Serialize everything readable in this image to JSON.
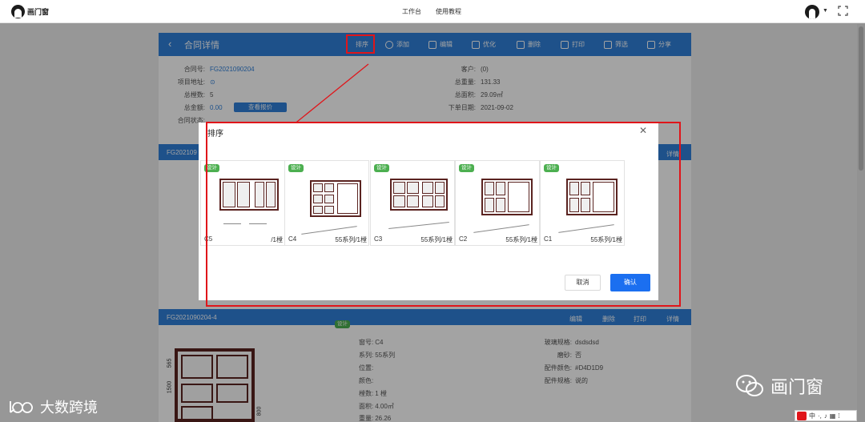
{
  "topbar": {
    "logo_text": "画门窗",
    "nav": [
      "工作台",
      "使用教程"
    ]
  },
  "detail": {
    "title": "合同详情",
    "toolbar": [
      {
        "label": "排序",
        "icon": "sort-icon"
      },
      {
        "label": "添加",
        "icon": "add-circle-icon"
      },
      {
        "label": "编辑",
        "icon": "edit-icon"
      },
      {
        "label": "优化",
        "icon": "grid-icon"
      },
      {
        "label": "删除",
        "icon": "trash-icon"
      },
      {
        "label": "打印",
        "icon": "printer-icon"
      },
      {
        "label": "筛选",
        "icon": "filter-icon"
      },
      {
        "label": "分享",
        "icon": "share-icon"
      }
    ],
    "info_left": [
      {
        "k": "合同号:",
        "v": "FG2021090204"
      },
      {
        "k": "项目地址:",
        "v": "⊙"
      },
      {
        "k": "总樘数:",
        "v": "5"
      },
      {
        "k": "总金额:",
        "v": "0.00"
      },
      {
        "k": "合同状态:",
        "v": ""
      }
    ],
    "quote_button": "查看报价",
    "info_right": [
      {
        "k": "客户:",
        "v": "(0)"
      },
      {
        "k": "总重量:",
        "v": "131.33"
      },
      {
        "k": "总面积:",
        "v": "29.09㎡"
      },
      {
        "k": "下单日期:",
        "v": "2021-09-02"
      }
    ]
  },
  "card1": {
    "id": "FG202109",
    "action": "详情"
  },
  "card2": {
    "id": "FG2021090204-4",
    "actions": [
      "编辑",
      "删除",
      "打印",
      "详情"
    ],
    "tag": "设计",
    "fields_mid": [
      {
        "k": "窗号:",
        "v": "C4"
      },
      {
        "k": "系列:",
        "v": "55系列"
      },
      {
        "k": "位置:",
        "v": ""
      },
      {
        "k": "颜色:",
        "v": ""
      },
      {
        "k": "樘数:",
        "v": "1 樘"
      },
      {
        "k": "面积:",
        "v": "4.00㎡"
      },
      {
        "k": "重量:",
        "v": "26.26"
      }
    ],
    "fields_right": [
      {
        "k": "玻璃规格:",
        "v": "dsdsdsd"
      },
      {
        "k": "磨砂:",
        "v": "否"
      },
      {
        "k": "配件颜色:",
        "v": "#D4D1D9"
      },
      {
        "k": "配件规格:",
        "v": "说的"
      }
    ],
    "dims": [
      "1500",
      "565",
      "800"
    ]
  },
  "modal": {
    "title": "排序",
    "close": "✕",
    "items": [
      {
        "tag": "设计",
        "code": "C5",
        "series": "/1樘"
      },
      {
        "tag": "设计",
        "code": "C4",
        "series": "55系列/1樘"
      },
      {
        "tag": "设计",
        "code": "C3",
        "series": "55系列/1樘"
      },
      {
        "tag": "设计",
        "code": "C2",
        "series": "55系列/1樘"
      },
      {
        "tag": "设计",
        "code": "C1",
        "series": "55系列/1樘"
      }
    ],
    "cancel": "取消",
    "confirm": "确认"
  },
  "watermarks": {
    "left": "大数跨境",
    "right": "画门窗"
  },
  "colors": {
    "primary": "#2f7fd8",
    "annotation_red": "#e0151a",
    "frame_brown": "#5a2320",
    "tag_green": "#4caf50"
  }
}
